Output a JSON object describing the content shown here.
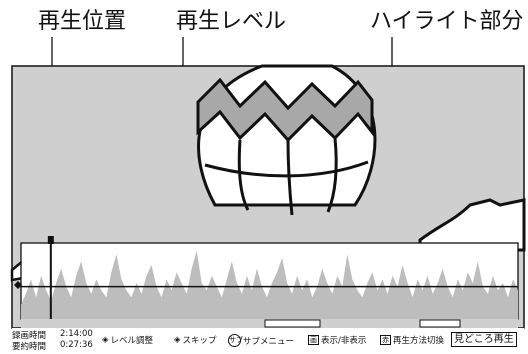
{
  "callouts": {
    "playback_position": "再生位置",
    "playback_level": "再生レベル",
    "highlight_part": "ハイライト部分"
  },
  "status": {
    "recording_time_label": "録画時間",
    "recording_time_value": "2:14:00",
    "summary_time_label": "要約時間",
    "summary_time_value": "0:27:36",
    "level_adjust": "レベル調整",
    "skip": "スキップ",
    "sub_menu_key": "サブ",
    "sub_menu": "サブメニュー",
    "display_key": "画",
    "display_toggle": "表示/非表示",
    "mode_key": "赤",
    "playback_method_switch": "再生方法切換",
    "digest_play": "見どころ再生"
  },
  "level_graph": {
    "playback_position_fraction": 0.06,
    "level_threshold": 0.45,
    "levels": [
      0.2,
      0.35,
      0.55,
      0.3,
      0.6,
      0.4,
      0.25,
      0.5,
      0.7,
      0.45,
      0.3,
      0.6,
      0.8,
      0.5,
      0.35,
      0.55,
      0.4,
      0.3,
      0.65,
      0.9,
      0.55,
      0.4,
      0.3,
      0.5,
      0.35,
      0.6,
      0.75,
      0.45,
      0.3,
      0.55,
      0.4,
      0.65,
      0.5,
      0.35,
      0.7,
      0.95,
      0.5,
      0.4,
      0.6,
      0.45,
      0.3,
      0.55,
      0.8,
      0.5,
      0.35,
      0.6,
      0.4,
      0.7,
      0.45,
      0.3,
      0.5,
      0.65,
      0.85,
      0.5,
      0.35,
      0.6,
      0.4,
      0.55,
      0.3,
      0.45,
      0.7,
      0.5,
      0.35,
      0.6,
      0.45,
      0.9,
      0.55,
      0.4,
      0.3,
      0.5,
      0.65,
      0.4,
      0.55,
      0.35,
      0.6,
      0.45,
      0.75,
      0.5,
      0.3,
      0.55,
      0.4,
      0.6,
      0.35,
      0.5,
      0.7,
      0.45,
      0.3,
      0.55,
      0.4,
      0.65,
      0.5,
      0.8,
      0.45,
      0.35,
      0.6,
      0.4,
      0.5,
      0.3,
      0.55,
      0.4
    ]
  },
  "colors": {
    "sky": "#cfcfcf",
    "balloon_panel": "#a8a8a8",
    "graph_fill": "#bdbdbd",
    "graph_bg": "#ffffff"
  }
}
